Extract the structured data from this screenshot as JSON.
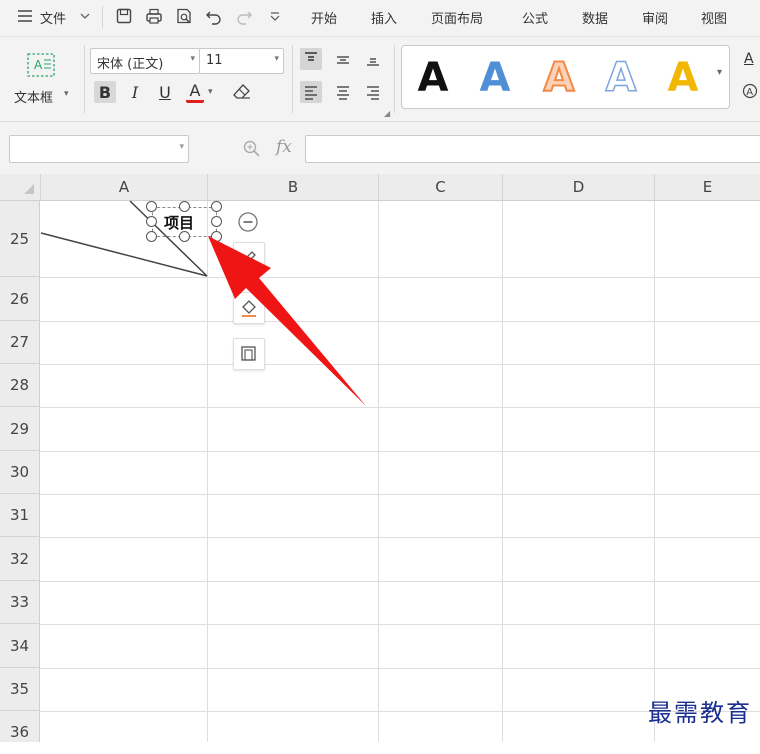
{
  "menubar": {
    "file_label": "文件",
    "tabs": [
      "开始",
      "插入",
      "页面布局",
      "公式",
      "数据",
      "审阅",
      "视图"
    ]
  },
  "ribbon": {
    "textbox_label": "文本框",
    "font_name": "宋体 (正文)",
    "font_size": "11",
    "bold": "B",
    "italic": "I",
    "underline": "U",
    "font_color_letter": "A",
    "wordart_letter": "A",
    "wordart_colors": [
      "#111111",
      "#4f8fd6",
      "#f08a4b",
      "#7ea6dd",
      "#f2b705"
    ]
  },
  "formula_bar": {
    "name_box": "",
    "fx_label": "fx",
    "formula": ""
  },
  "grid": {
    "columns": [
      "A",
      "B",
      "C",
      "D",
      "E"
    ],
    "rows": [
      "25",
      "26",
      "27",
      "28",
      "29",
      "30",
      "31",
      "32",
      "33",
      "34",
      "35",
      "36"
    ]
  },
  "textbox": {
    "text": "项目"
  },
  "arrow_color": "#f01515",
  "watermark": "最需教育"
}
